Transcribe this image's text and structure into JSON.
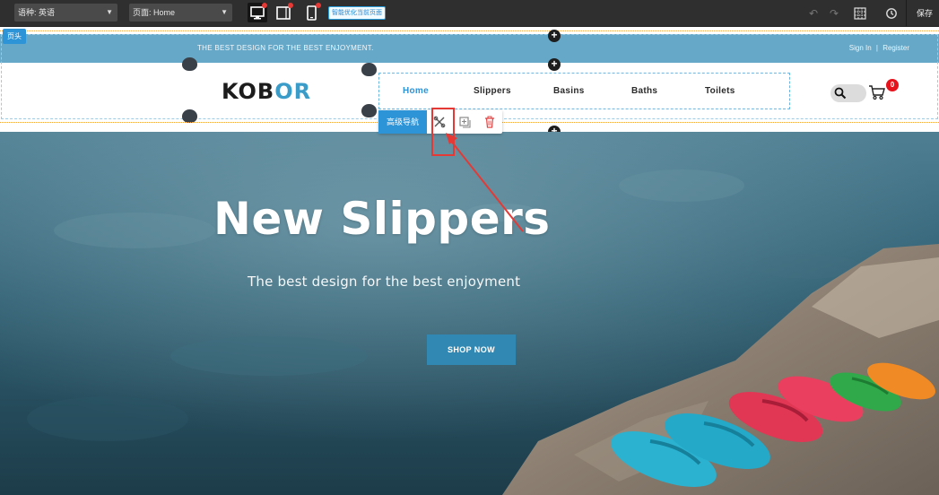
{
  "toolbar": {
    "language_label": "语种: 英语",
    "page_label": "页面: Home",
    "smart_button": "智能优化当前页面",
    "save_label": "保存"
  },
  "editor": {
    "header_tag": "页头",
    "component_name": "高级导航"
  },
  "site": {
    "topbar_text": "THE BEST DESIGN FOR THE BEST ENJOYMENT.",
    "sign_in": "Sign In",
    "separator": "|",
    "register": "Register",
    "logo_part1": "KOB",
    "logo_part2": "OR",
    "nav": [
      "Home",
      "Slippers",
      "Basins",
      "Baths",
      "Toilets"
    ],
    "cart_count": "0",
    "accent_color": "#3a9cc8"
  },
  "hero": {
    "title": "New Slippers",
    "subtitle": "The best design for the best enjoyment",
    "button": "SHOP NOW"
  },
  "icons": [
    "chevron-down-icon",
    "desktop-icon",
    "tablet-icon",
    "mobile-icon",
    "undo-icon",
    "redo-icon",
    "grid-icon",
    "history-icon",
    "plus-icon",
    "search-icon",
    "cart-icon",
    "edit-icon",
    "copy-icon",
    "trash-icon"
  ]
}
